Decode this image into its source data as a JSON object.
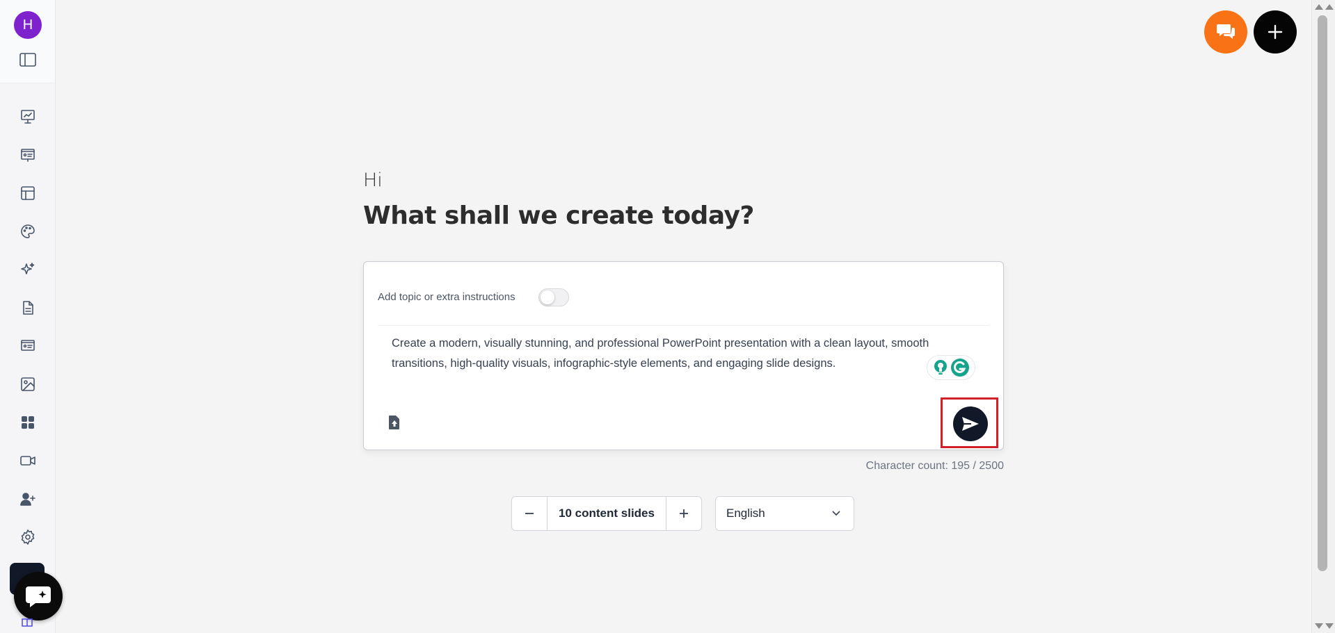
{
  "sidebar": {
    "avatar_letter": "H",
    "nav_items": [
      {
        "icon": "presentation-chart-icon"
      },
      {
        "icon": "slides-icon"
      },
      {
        "icon": "layout-icon"
      },
      {
        "icon": "palette-icon"
      },
      {
        "icon": "sparkles-icon"
      },
      {
        "icon": "document-icon"
      },
      {
        "icon": "slideshow-icon"
      },
      {
        "icon": "image-icon"
      },
      {
        "icon": "apps-grid-icon"
      },
      {
        "icon": "video-icon"
      },
      {
        "icon": "add-user-icon"
      },
      {
        "icon": "settings-icon"
      }
    ]
  },
  "main": {
    "greeting": "Hi",
    "headline": "What shall we create today?",
    "prompt_card": {
      "topic_toggle_label": "Add topic or extra instructions",
      "topic_toggle_on": false,
      "prompt_text": "Create a modern, visually stunning, and professional PowerPoint presentation with a clean layout, smooth transitions, high-quality visuals, infographic-style elements, and engaging slide designs."
    },
    "char_count": "Character count: 195 / 2500",
    "slides_count_label": "10 content slides",
    "language": "English"
  },
  "colors": {
    "accent_orange": "#f97316",
    "avatar_purple": "#7e22ce",
    "highlight_red": "#d0202a"
  }
}
